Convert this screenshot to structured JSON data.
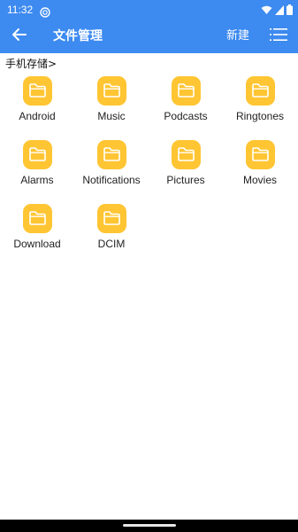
{
  "status_bar": {
    "time": "11:32"
  },
  "app_bar": {
    "title": "文件管理",
    "new_label": "新建"
  },
  "breadcrumb": {
    "path": "手机存储>"
  },
  "folders": [
    {
      "label": "Android"
    },
    {
      "label": "Music"
    },
    {
      "label": "Podcasts"
    },
    {
      "label": "Ringtones"
    },
    {
      "label": "Alarms"
    },
    {
      "label": "Notifications"
    },
    {
      "label": "Pictures"
    },
    {
      "label": "Movies"
    },
    {
      "label": "Download"
    },
    {
      "label": "DCIM"
    }
  ],
  "colors": {
    "app_bar_bg": "#3d8af0",
    "folder_icon_bg": "#ffc533",
    "folder_glyph": "#ffffff"
  },
  "icons": {
    "back": "arrow-left-icon",
    "menu": "menu-lines-icon",
    "folder": "folder-icon"
  }
}
